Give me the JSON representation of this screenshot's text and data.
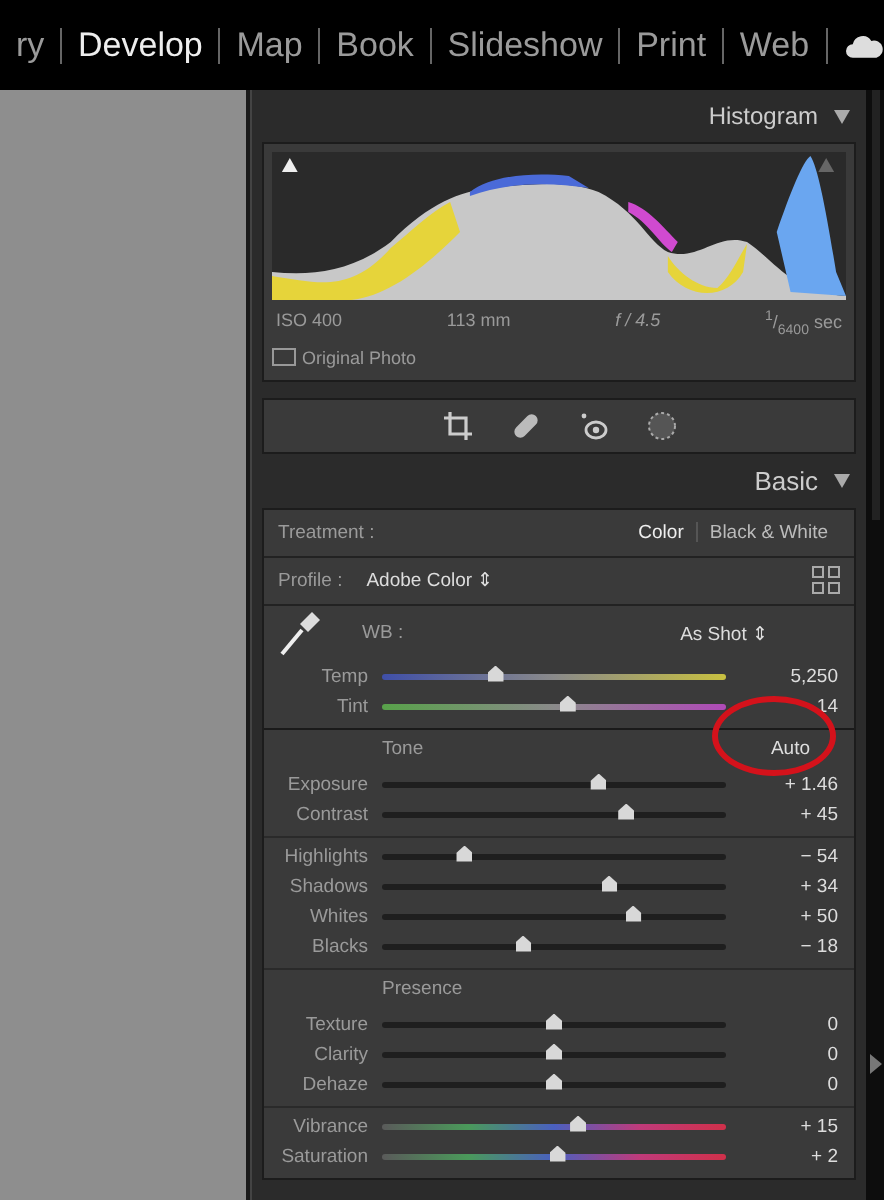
{
  "module_nav": [
    {
      "label": "ry",
      "selected": false
    },
    {
      "label": "Develop",
      "selected": true
    },
    {
      "label": "Map",
      "selected": false
    },
    {
      "label": "Book",
      "selected": false
    },
    {
      "label": "Slideshow",
      "selected": false
    },
    {
      "label": "Print",
      "selected": false
    },
    {
      "label": "Web",
      "selected": false
    }
  ],
  "histogram": {
    "title": "Histogram",
    "iso": "ISO 400",
    "focal": "113 mm",
    "aperture": "f / 4.5",
    "shutter": "$^{1}$/$_{6400}$ sec",
    "original_photo": {
      "label": "Original Photo",
      "checked": false
    }
  },
  "basic": {
    "title": "Basic",
    "treatment": {
      "label": "Treatment :",
      "options": [
        {
          "label": "Color",
          "selected": true
        },
        {
          "label": "Black & White",
          "selected": false
        }
      ]
    },
    "profile": {
      "label": "Profile :",
      "value": "Adobe Color ⇕"
    },
    "wb": {
      "label": "WB :",
      "value": "As Shot ⇕",
      "sliders": [
        {
          "name": "Temp",
          "kind": "temp",
          "level": 0.33,
          "reading": "5,250"
        },
        {
          "name": "Tint",
          "kind": "tint",
          "level": 0.54,
          "reading": "14"
        }
      ]
    },
    "groups": [
      {
        "heading": "Tone",
        "action": "Auto",
        "sliders": [
          {
            "name": "Exposure",
            "kind": "plain",
            "level": 0.63,
            "reading": "+ 1.46"
          },
          {
            "name": "Contrast",
            "kind": "plain",
            "level": 0.71,
            "reading": "+ 45"
          }
        ]
      },
      {
        "sliders": [
          {
            "name": "Highlights",
            "kind": "plain",
            "level": 0.24,
            "reading": "− 54"
          },
          {
            "name": "Shadows",
            "kind": "plain",
            "level": 0.66,
            "reading": "+ 34"
          },
          {
            "name": "Whites",
            "kind": "plain",
            "level": 0.73,
            "reading": "+ 50"
          },
          {
            "name": "Blacks",
            "kind": "plain",
            "level": 0.41,
            "reading": "− 18"
          }
        ]
      },
      {
        "heading": "Presence",
        "sliders": [
          {
            "name": "Texture",
            "kind": "plain",
            "level": 0.5,
            "reading": "0"
          },
          {
            "name": "Clarity",
            "kind": "plain",
            "level": 0.5,
            "reading": "0"
          },
          {
            "name": "Dehaze",
            "kind": "plain",
            "level": 0.5,
            "reading": "0"
          }
        ]
      },
      {
        "sliders": [
          {
            "name": "Vibrance",
            "kind": "color",
            "level": 0.57,
            "reading": "+ 15"
          },
          {
            "name": "Saturation",
            "kind": "color",
            "level": 0.51,
            "reading": "+ 2"
          }
        ]
      }
    ]
  }
}
